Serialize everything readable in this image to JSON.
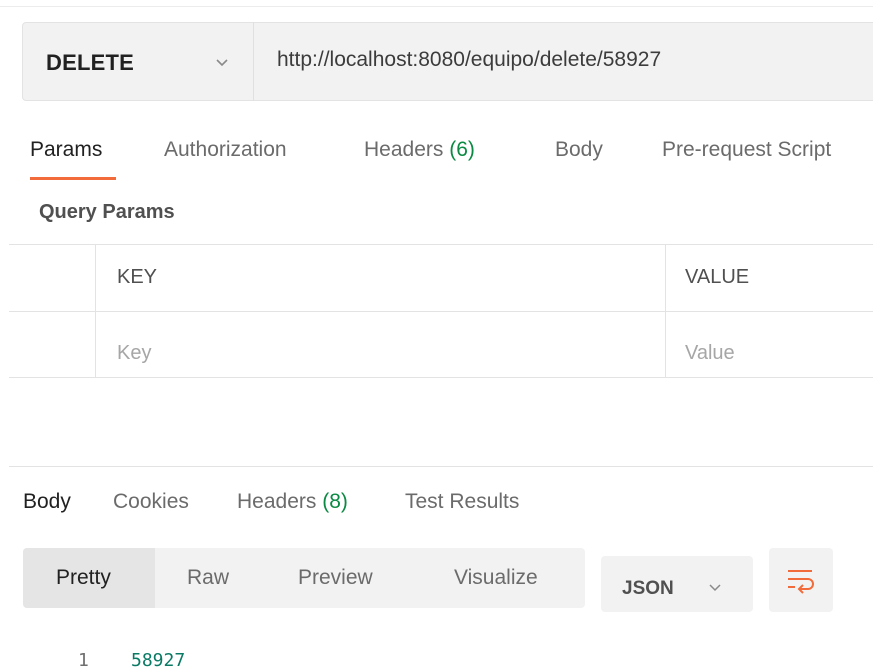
{
  "request": {
    "method": "DELETE",
    "url": "http://localhost:8080/equipo/delete/58927",
    "tabs": [
      {
        "label": "Params",
        "active": true
      },
      {
        "label": "Authorization"
      },
      {
        "label": "Headers",
        "count": "(6)"
      },
      {
        "label": "Body"
      },
      {
        "label": "Pre-request Script"
      }
    ]
  },
  "params": {
    "section_title": "Query Params",
    "columns": [
      "KEY",
      "VALUE"
    ],
    "placeholders": {
      "key": "Key",
      "value": "Value"
    }
  },
  "response": {
    "tabs": [
      {
        "label": "Body",
        "active": true
      },
      {
        "label": "Cookies"
      },
      {
        "label": "Headers",
        "count": "(8)"
      },
      {
        "label": "Test Results"
      }
    ],
    "view_modes": [
      "Pretty",
      "Raw",
      "Preview",
      "Visualize"
    ],
    "active_view": "Pretty",
    "format": "JSON",
    "body_lines": [
      {
        "line": "1",
        "text": "58927"
      }
    ]
  },
  "icons": {
    "method_dropdown": "chevron-down-icon",
    "format_dropdown": "chevron-down-icon",
    "wrap": "wrap-lines-icon"
  },
  "colors": {
    "accent": "#f26b3a",
    "count_green": "#0b8a43",
    "code_green": "#0a7a64"
  }
}
